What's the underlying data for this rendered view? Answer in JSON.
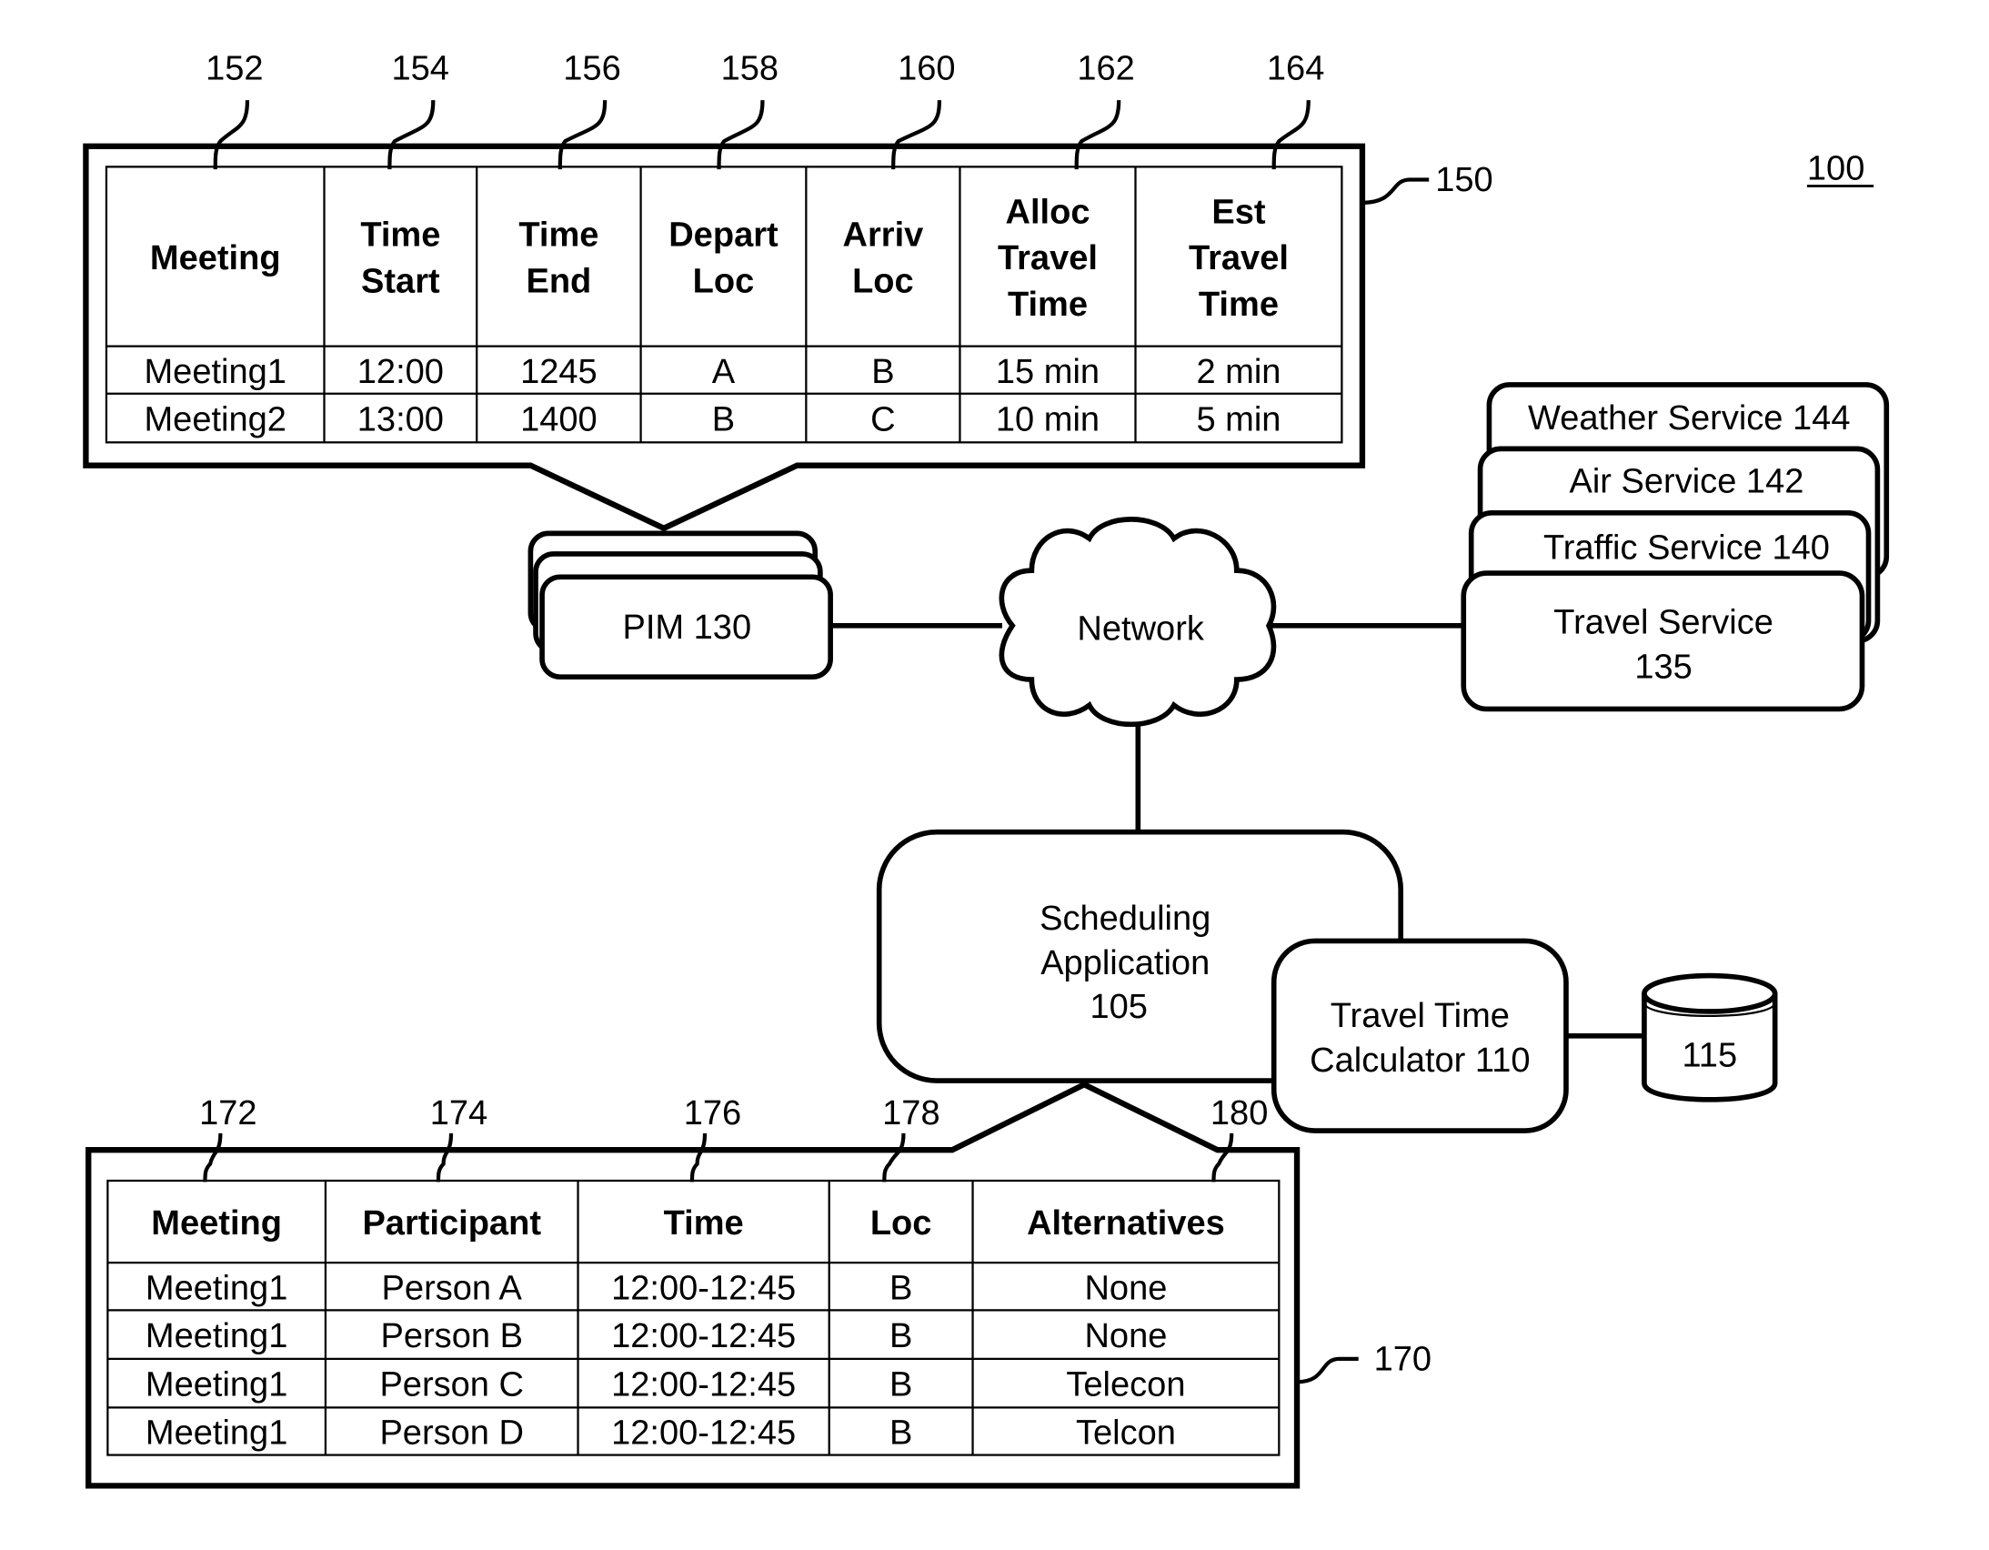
{
  "figure_ref": "100",
  "table_top": {
    "ref": "150",
    "column_refs": [
      "152",
      "154",
      "156",
      "158",
      "160",
      "162",
      "164"
    ],
    "headers": [
      [
        "Meeting"
      ],
      [
        "Time",
        "Start"
      ],
      [
        "Time",
        "End"
      ],
      [
        "Depart",
        "Loc"
      ],
      [
        "Arriv",
        "Loc"
      ],
      [
        "Alloc",
        "Travel",
        "Time"
      ],
      [
        "Est",
        "Travel",
        "Time"
      ]
    ],
    "rows": [
      [
        "Meeting1",
        "12:00",
        "1245",
        "A",
        "B",
        "15 min",
        "2 min"
      ],
      [
        "Meeting2",
        "13:00",
        "1400",
        "B",
        "C",
        "10 min",
        "5 min"
      ]
    ]
  },
  "pim": {
    "label": "PIM 130"
  },
  "network": {
    "label": "Network"
  },
  "services": [
    {
      "label": "Weather Service 144"
    },
    {
      "label": "Air Service 142"
    },
    {
      "label": "Traffic Service 140"
    },
    {
      "label_lines": [
        "Travel Service",
        "135"
      ]
    }
  ],
  "scheduling_app": {
    "label_lines": [
      "Scheduling",
      "Application",
      "105"
    ]
  },
  "calculator": {
    "label_lines": [
      "Travel Time",
      "Calculator 110"
    ]
  },
  "database": {
    "label": "115"
  },
  "table_bottom": {
    "ref": "170",
    "column_refs": [
      "172",
      "174",
      "176",
      "178",
      "180"
    ],
    "headers": [
      "Meeting",
      "Participant",
      "Time",
      "Loc",
      "Alternatives"
    ],
    "rows": [
      [
        "Meeting1",
        "Person A",
        "12:00-12:45",
        "B",
        "None"
      ],
      [
        "Meeting1",
        "Person B",
        "12:00-12:45",
        "B",
        "None"
      ],
      [
        "Meeting1",
        "Person C",
        "12:00-12:45",
        "B",
        "Telecon"
      ],
      [
        "Meeting1",
        "Person D",
        "12:00-12:45",
        "B",
        "Telcon"
      ]
    ]
  }
}
